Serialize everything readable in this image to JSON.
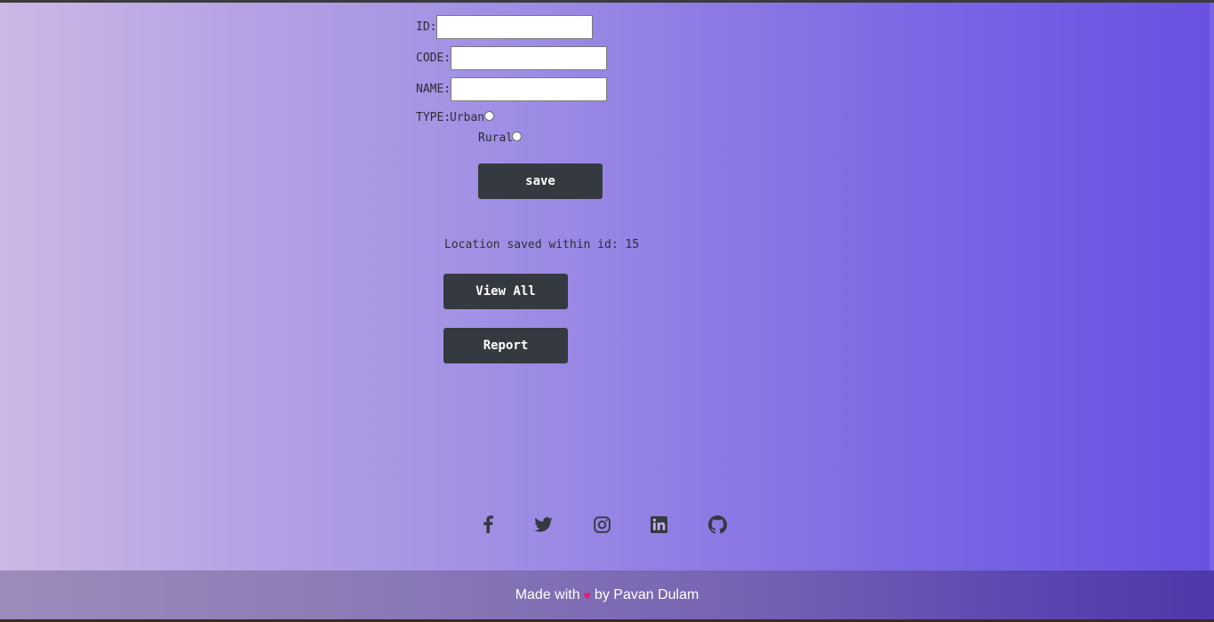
{
  "form": {
    "id_label": "ID:",
    "id_value": "",
    "code_label": "CODE:",
    "code_value": "",
    "name_label": "NAME:",
    "name_value": "",
    "type_label": "TYPE:",
    "type_options": [
      "Urban",
      "Rural"
    ],
    "save_label": "save"
  },
  "status": {
    "message": "Location saved within id: 15"
  },
  "actions": {
    "view_all_label": "View All",
    "report_label": "Report"
  },
  "social": {
    "icons": [
      "facebook-icon",
      "twitter-icon",
      "instagram-icon",
      "linkedin-icon",
      "github-icon"
    ]
  },
  "footer": {
    "made_with": "Made with",
    "heart": "♥",
    "by": "by Pavan Dulam"
  },
  "colors": {
    "button_bg": "#343a40",
    "heart": "#e8186b",
    "gradient_start": "#ccb8e4",
    "gradient_end": "#6a50e2"
  }
}
